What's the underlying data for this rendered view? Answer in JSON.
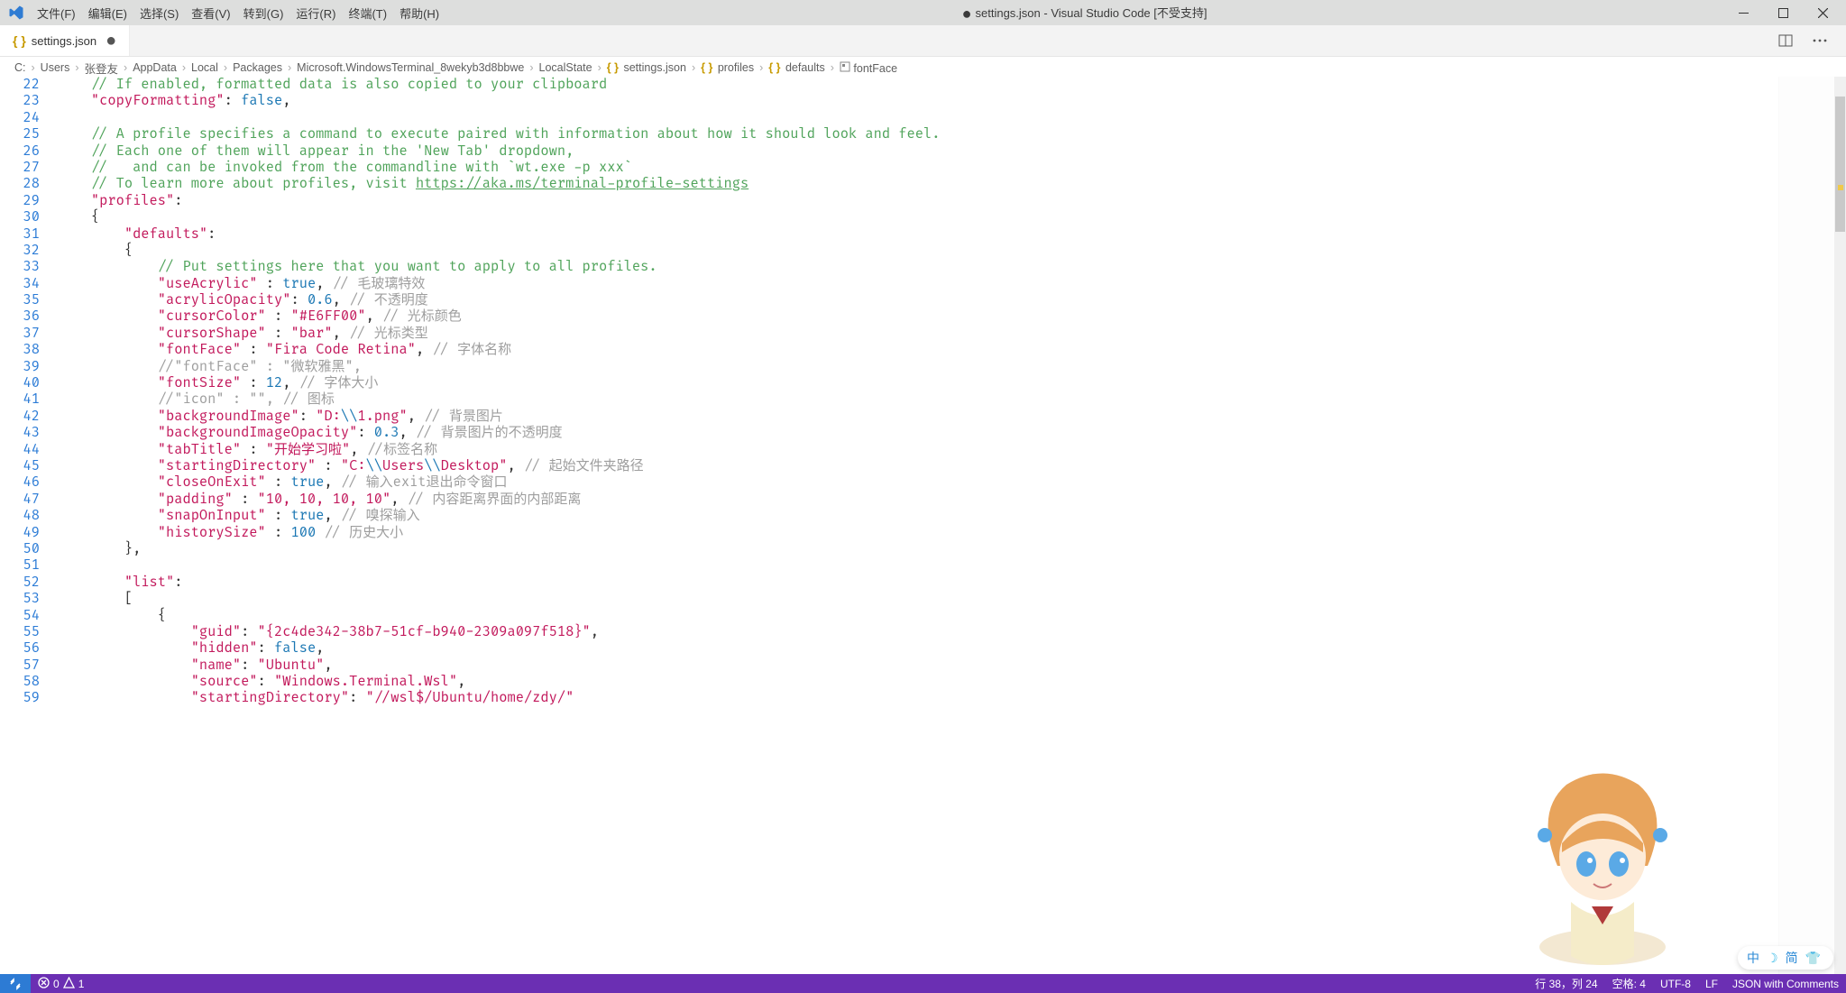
{
  "menu": [
    "文件(F)",
    "编辑(E)",
    "选择(S)",
    "查看(V)",
    "转到(G)",
    "运行(R)",
    "终端(T)",
    "帮助(H)"
  ],
  "window_title": "settings.json - Visual Studio Code [不受支持]",
  "tab": {
    "label": "settings.json"
  },
  "breadcrumbs": [
    "C:",
    "Users",
    "张登友",
    "AppData",
    "Local",
    "Packages",
    "Microsoft.WindowsTerminal_8wekyb3d8bbwe",
    "LocalState",
    "settings.json",
    "profiles",
    "defaults",
    "fontFace"
  ],
  "gutter_start": 22,
  "highlight_line_index": 16,
  "code_lines": [
    [
      [
        "cmt",
        "    // If enabled, formatted data is also copied to your clipboard"
      ]
    ],
    [
      [
        "key",
        "    \"copyFormatting\""
      ],
      [
        "pun",
        ": "
      ],
      [
        "bool",
        "false"
      ],
      [
        "pun",
        ","
      ]
    ],
    [
      [
        "pun",
        ""
      ]
    ],
    [
      [
        "cmt",
        "    // A profile specifies a command to execute paired with information about how it should look and feel."
      ]
    ],
    [
      [
        "cmt",
        "    // Each one of them will appear in the 'New Tab' dropdown,"
      ]
    ],
    [
      [
        "cmt",
        "    //   and can be invoked from the commandline with `wt.exe -p xxx`"
      ]
    ],
    [
      [
        "cmt",
        "    // To learn more about profiles, visit "
      ],
      [
        "link",
        "https://aka.ms/terminal-profile-settings"
      ]
    ],
    [
      [
        "key",
        "    \"profiles\""
      ],
      [
        "pun",
        ":"
      ]
    ],
    [
      [
        "pun",
        "    {"
      ]
    ],
    [
      [
        "key",
        "        \"defaults\""
      ],
      [
        "pun",
        ":"
      ]
    ],
    [
      [
        "pun",
        "        {"
      ]
    ],
    [
      [
        "cmt",
        "            // Put settings here that you want to apply to all profiles."
      ]
    ],
    [
      [
        "key",
        "            \"useAcrylic\" "
      ],
      [
        "pun",
        ": "
      ],
      [
        "bool",
        "true"
      ],
      [
        "pun",
        ", "
      ],
      [
        "cn",
        "// 毛玻璃特效"
      ]
    ],
    [
      [
        "key",
        "            \"acrylicOpacity\""
      ],
      [
        "pun",
        ": "
      ],
      [
        "num",
        "0.6"
      ],
      [
        "pun",
        ", "
      ],
      [
        "cn",
        "// 不透明度"
      ]
    ],
    [
      [
        "key",
        "            \"cursorColor\" "
      ],
      [
        "pun",
        ": "
      ],
      [
        "str",
        "\"#E6FF00\""
      ],
      [
        "pun",
        ", "
      ],
      [
        "cn",
        "// 光标颜色"
      ]
    ],
    [
      [
        "key",
        "            \"cursorShape\" "
      ],
      [
        "pun",
        ": "
      ],
      [
        "str",
        "\"bar\""
      ],
      [
        "pun",
        ", "
      ],
      [
        "cn",
        "// 光标类型"
      ]
    ],
    [
      [
        "key",
        "            \"fontFace\" "
      ],
      [
        "pun",
        ": "
      ],
      [
        "str",
        "\"Fira Code Retina\""
      ],
      [
        "pun",
        ", "
      ],
      [
        "cn",
        "// 字体名称"
      ]
    ],
    [
      [
        "dim",
        "            //\"fontFace\" : \"微软雅黑\","
      ]
    ],
    [
      [
        "key",
        "            \"fontSize\" "
      ],
      [
        "pun",
        ": "
      ],
      [
        "num",
        "12"
      ],
      [
        "pun",
        ", "
      ],
      [
        "cn",
        "// 字体大小"
      ]
    ],
    [
      [
        "dim",
        "            //\"icon\" : \"\", "
      ],
      [
        "cn",
        "// 图标"
      ]
    ],
    [
      [
        "key",
        "            \"backgroundImage\""
      ],
      [
        "pun",
        ": "
      ],
      [
        "path",
        "\"D:"
      ],
      [
        "esc",
        "\\\\"
      ],
      [
        "path",
        "1.png\""
      ],
      [
        "pun",
        ", "
      ],
      [
        "cn",
        "// 背景图片"
      ]
    ],
    [
      [
        "key",
        "            \"backgroundImageOpacity\""
      ],
      [
        "pun",
        ": "
      ],
      [
        "num",
        "0.3"
      ],
      [
        "pun",
        ", "
      ],
      [
        "cn",
        "// 背景图片的不透明度"
      ]
    ],
    [
      [
        "key",
        "            \"tabTitle\" "
      ],
      [
        "pun",
        ": "
      ],
      [
        "str",
        "\"开始学习啦\""
      ],
      [
        "pun",
        ", "
      ],
      [
        "cn",
        "//标签名称"
      ]
    ],
    [
      [
        "key",
        "            \"startingDirectory\" "
      ],
      [
        "pun",
        ": "
      ],
      [
        "path",
        "\"C:"
      ],
      [
        "esc",
        "\\\\"
      ],
      [
        "path",
        "Users"
      ],
      [
        "esc",
        "\\\\"
      ],
      [
        "path",
        "Desktop\""
      ],
      [
        "pun",
        ", "
      ],
      [
        "cn",
        "// 起始文件夹路径"
      ]
    ],
    [
      [
        "key",
        "            \"closeOnExit\" "
      ],
      [
        "pun",
        ": "
      ],
      [
        "bool",
        "true"
      ],
      [
        "pun",
        ", "
      ],
      [
        "cn",
        "// 输入exit退出命令窗口"
      ]
    ],
    [
      [
        "key",
        "            \"padding\" "
      ],
      [
        "pun",
        ": "
      ],
      [
        "str",
        "\"10, 10, 10, 10\""
      ],
      [
        "pun",
        ", "
      ],
      [
        "cn",
        "// 内容距离界面的内部距离"
      ]
    ],
    [
      [
        "key",
        "            \"snapOnInput\" "
      ],
      [
        "pun",
        ": "
      ],
      [
        "bool",
        "true"
      ],
      [
        "pun",
        ", "
      ],
      [
        "cn",
        "// 嗅探输入"
      ]
    ],
    [
      [
        "key",
        "            \"historySize\" "
      ],
      [
        "pun",
        ": "
      ],
      [
        "num",
        "100"
      ],
      [
        "pun",
        " "
      ],
      [
        "cn",
        "// 历史大小"
      ]
    ],
    [
      [
        "pun",
        "        },"
      ]
    ],
    [
      [
        "pun",
        ""
      ]
    ],
    [
      [
        "key",
        "        \"list\""
      ],
      [
        "pun",
        ":"
      ]
    ],
    [
      [
        "pun",
        "        ["
      ]
    ],
    [
      [
        "pun",
        "            {"
      ]
    ],
    [
      [
        "key",
        "                \"guid\""
      ],
      [
        "pun",
        ": "
      ],
      [
        "str",
        "\"{2c4de342-38b7-51cf-b940-2309a097f518}\""
      ],
      [
        "pun",
        ","
      ]
    ],
    [
      [
        "key",
        "                \"hidden\""
      ],
      [
        "pun",
        ": "
      ],
      [
        "bool",
        "false"
      ],
      [
        "pun",
        ","
      ]
    ],
    [
      [
        "key",
        "                \"name\""
      ],
      [
        "pun",
        ": "
      ],
      [
        "str",
        "\"Ubuntu\""
      ],
      [
        "pun",
        ","
      ]
    ],
    [
      [
        "key",
        "                \"source\""
      ],
      [
        "pun",
        ": "
      ],
      [
        "str",
        "\"Windows.Terminal.Wsl\""
      ],
      [
        "pun",
        ","
      ]
    ],
    [
      [
        "key",
        "                \"startingDirectory\""
      ],
      [
        "pun",
        ": "
      ],
      [
        "str",
        "\"//wsl$/Ubuntu/home/zdy/\""
      ]
    ]
  ],
  "status": {
    "errors": "0",
    "warnings": "1",
    "line_col": "行 38，列 24",
    "spaces": "空格: 4",
    "encoding": "UTF-8",
    "eol": "LF",
    "lang": "JSON with Comments"
  },
  "ime": {
    "zh": "中",
    "jian": "简"
  }
}
